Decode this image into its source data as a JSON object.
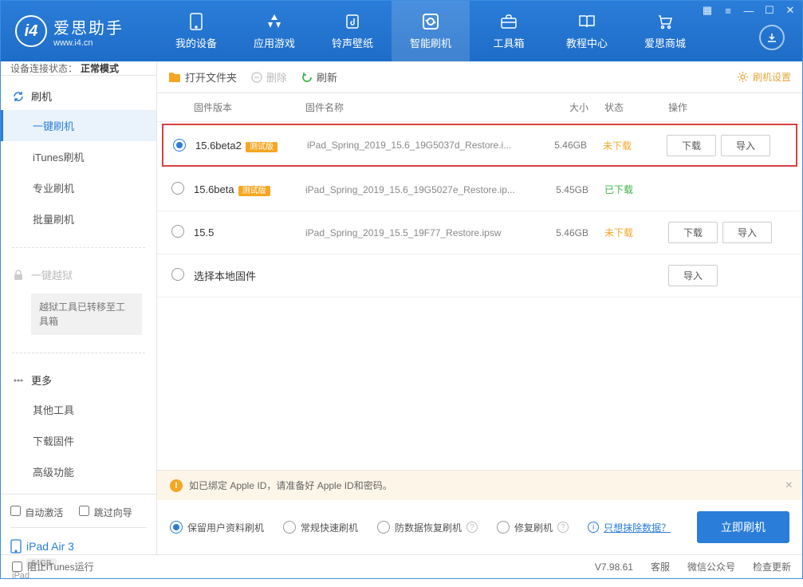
{
  "logo": {
    "title": "爱思助手",
    "url": "www.i4.cn"
  },
  "nav": [
    {
      "label": "我的设备"
    },
    {
      "label": "应用游戏"
    },
    {
      "label": "铃声壁纸"
    },
    {
      "label": "智能刷机"
    },
    {
      "label": "工具箱"
    },
    {
      "label": "教程中心"
    },
    {
      "label": "爱思商城"
    }
  ],
  "sidebar": {
    "status_label": "设备连接状态：",
    "status_value": "正常模式",
    "flash_title": "刷机",
    "items": [
      {
        "label": "一键刷机"
      },
      {
        "label": "iTunes刷机"
      },
      {
        "label": "专业刷机"
      },
      {
        "label": "批量刷机"
      }
    ],
    "jailbreak_title": "一键越狱",
    "jailbreak_note": "越狱工具已转移至工具箱",
    "more_title": "更多",
    "more_items": [
      {
        "label": "其他工具"
      },
      {
        "label": "下载固件"
      },
      {
        "label": "高级功能"
      }
    ],
    "auto_activate": "自动激活",
    "skip_guide": "跳过向导",
    "device_name": "iPad Air 3",
    "device_storage": "64GB",
    "device_type": "iPad"
  },
  "toolbar": {
    "open_folder": "打开文件夹",
    "delete": "删除",
    "refresh": "刷新",
    "settings": "刷机设置"
  },
  "columns": {
    "version": "固件版本",
    "name": "固件名称",
    "size": "大小",
    "status": "状态",
    "ops": "操作"
  },
  "firmware": [
    {
      "version": "15.6beta2",
      "beta": "测试版",
      "name": "iPad_Spring_2019_15.6_19G5037d_Restore.i...",
      "size": "5.46GB",
      "status": "未下载",
      "status_class": "st-orange",
      "selected": true,
      "highlighted": true,
      "show_ops": true
    },
    {
      "version": "15.6beta",
      "beta": "测试版",
      "name": "iPad_Spring_2019_15.6_19G5027e_Restore.ip...",
      "size": "5.45GB",
      "status": "已下载",
      "status_class": "st-green",
      "selected": false,
      "show_ops": false
    },
    {
      "version": "15.5",
      "beta": "",
      "name": "iPad_Spring_2019_15.5_19F77_Restore.ipsw",
      "size": "5.46GB",
      "status": "未下载",
      "status_class": "st-orange",
      "selected": false,
      "show_ops": true
    }
  ],
  "local_fw": "选择本地固件",
  "ops": {
    "download": "下载",
    "import": "导入"
  },
  "warn": "如已绑定 Apple ID，请准备好 Apple ID和密码。",
  "modes": [
    {
      "label": "保留用户资料刷机",
      "checked": true,
      "help": false
    },
    {
      "label": "常规快速刷机",
      "checked": false,
      "help": false
    },
    {
      "label": "防数据恢复刷机",
      "checked": false,
      "help": true
    },
    {
      "label": "修复刷机",
      "checked": false,
      "help": true
    }
  ],
  "erase_link": "只想抹除数据？",
  "flash_now": "立即刷机",
  "footer": {
    "block_itunes": "阻止iTunes运行",
    "version": "V7.98.61",
    "service": "客服",
    "wechat": "微信公众号",
    "update": "检查更新"
  }
}
